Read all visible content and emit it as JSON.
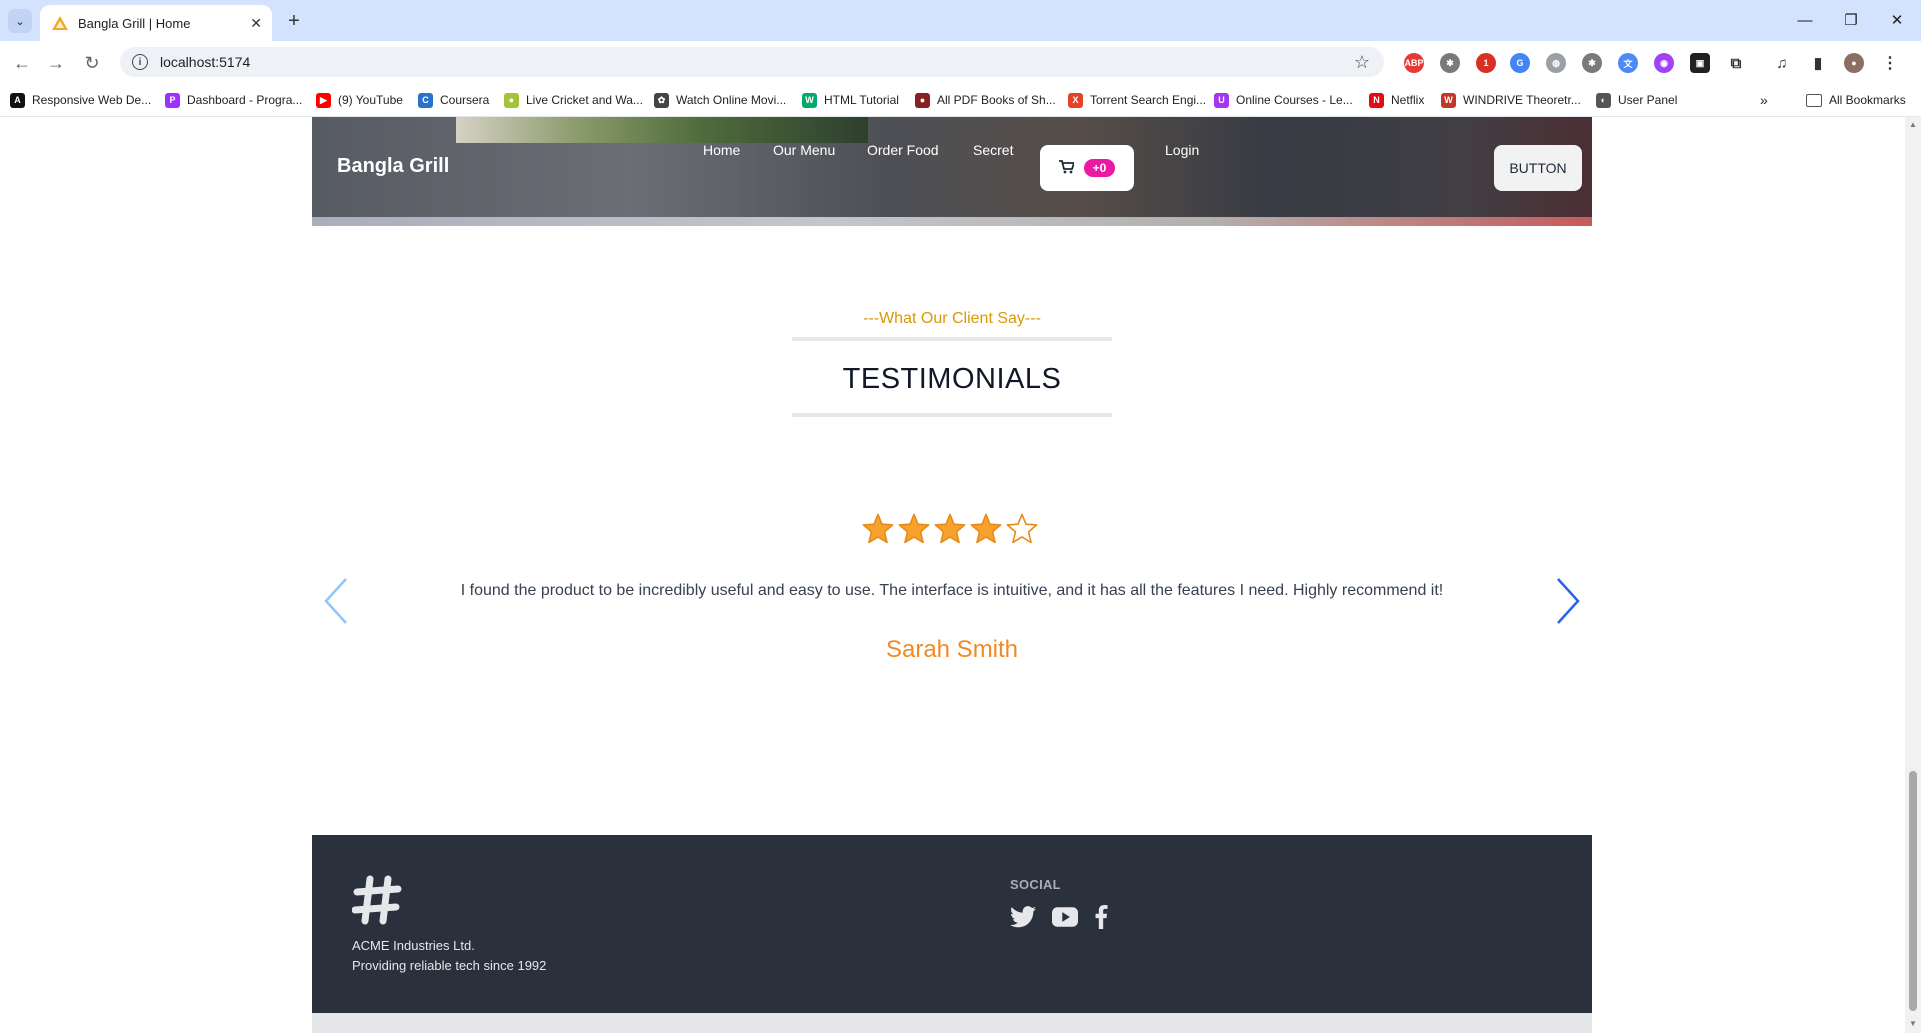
{
  "browser": {
    "tab_title": "Bangla Grill | Home",
    "url": "localhost:5174",
    "tab_list_icon": "chevron-down-icon",
    "new_tab_icon": "plus-icon",
    "extension_badge": "1",
    "bookmarks": [
      {
        "label": "Responsive Web De...",
        "color": "#111111",
        "glyph": "A"
      },
      {
        "label": "Dashboard - Progra...",
        "color": "#9b30ff",
        "glyph": "P"
      },
      {
        "label": "(9) YouTube",
        "color": "#ff0000",
        "glyph": "▶"
      },
      {
        "label": "Coursera",
        "color": "#2a73cc",
        "glyph": "C"
      },
      {
        "label": "Live Cricket and Wa...",
        "color": "#a3c43a",
        "glyph": "●"
      },
      {
        "label": "Watch Online Movi...",
        "color": "#444444",
        "glyph": "✿"
      },
      {
        "label": "HTML Tutorial",
        "color": "#04aa6d",
        "glyph": "W"
      },
      {
        "label": "All PDF Books of Sh...",
        "color": "#8b1e1e",
        "glyph": "●"
      },
      {
        "label": "Torrent Search Engi...",
        "color": "#e8412b",
        "glyph": "X"
      },
      {
        "label": "Online Courses - Le...",
        "color": "#a435f0",
        "glyph": "U"
      },
      {
        "label": "Netflix",
        "color": "#e50914",
        "glyph": "N"
      },
      {
        "label": "WINDRIVE Theoretr...",
        "color": "#c0392b",
        "glyph": "W"
      },
      {
        "label": "User Panel",
        "color": "#555555",
        "glyph": "◐"
      }
    ],
    "all_bookmarks_label": "All Bookmarks",
    "more_bookmarks": "»"
  },
  "navbar": {
    "brand": "Bangla Grill",
    "links": [
      "Home",
      "Our Menu",
      "Order Food",
      "Secret"
    ],
    "cart_count": "+0",
    "login": "Login",
    "button": "BUTTON"
  },
  "testimonials": {
    "subheading": "---What Our Client Say---",
    "heading": "TESTIMONIALS",
    "rating": 4,
    "rating_max": 5,
    "quote": "I found the product to be incredibly useful and easy to use. The interface is intuitive, and it has all the features I need. Highly recommend it!",
    "author": "Sarah Smith",
    "accent_color": "#f08a24"
  },
  "footer": {
    "company_line1": "ACME Industries Ltd.",
    "company_line2": "Providing reliable tech since 1992",
    "social_title": "SOCIAL",
    "social": [
      "twitter-icon",
      "youtube-icon",
      "facebook-icon"
    ],
    "background": "#2a303c"
  }
}
